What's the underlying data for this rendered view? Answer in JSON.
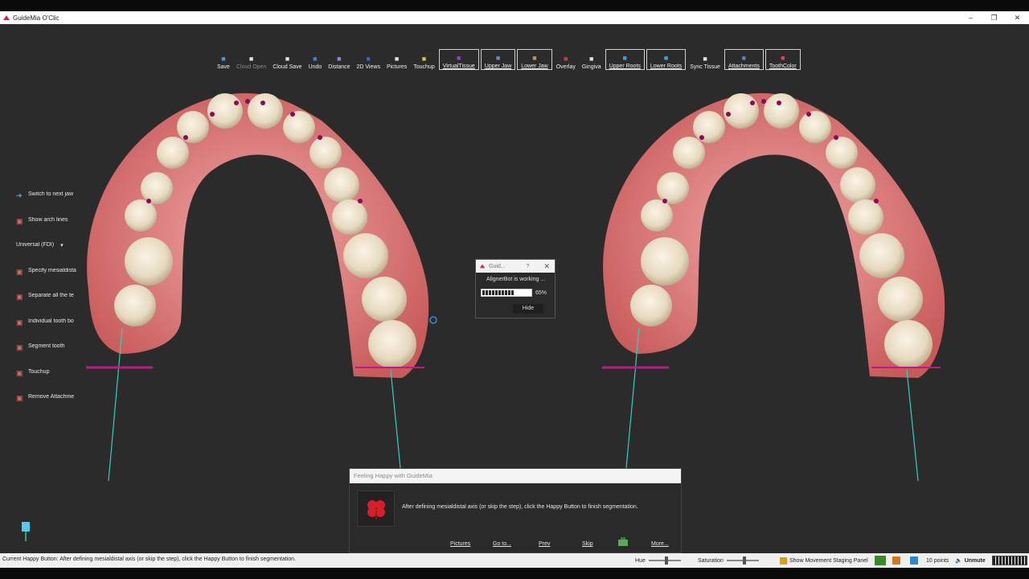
{
  "window": {
    "title": "GuideMia O'Clic",
    "minimize": "–",
    "restore": "❐",
    "close": "✕"
  },
  "toolbar": [
    {
      "label": "Save",
      "icon": "save-icon",
      "boxed": false,
      "disabled": false
    },
    {
      "label": "Cloud Open",
      "icon": "cloud-open-icon",
      "boxed": false,
      "disabled": true
    },
    {
      "label": "Cloud Save",
      "icon": "cloud-save-icon",
      "boxed": false,
      "disabled": false
    },
    {
      "label": "Undo",
      "icon": "undo-icon",
      "boxed": false,
      "disabled": false
    },
    {
      "label": "Distance",
      "icon": "distance-icon",
      "boxed": false,
      "disabled": false
    },
    {
      "label": "2D Views",
      "icon": "2d-views-icon",
      "boxed": false,
      "disabled": false
    },
    {
      "label": "Pictures",
      "icon": "pictures-icon",
      "boxed": false,
      "disabled": false
    },
    {
      "label": "Touchup",
      "icon": "touchup-icon",
      "boxed": false,
      "disabled": false
    },
    {
      "label": "VirtualTissue",
      "icon": "virtual-tissue-icon",
      "boxed": true,
      "disabled": false
    },
    {
      "label": "Upper Jaw",
      "icon": "upper-jaw-icon",
      "boxed": true,
      "disabled": false
    },
    {
      "label": "Lower Jaw",
      "icon": "lower-jaw-icon",
      "boxed": true,
      "disabled": false
    },
    {
      "label": "Overlay",
      "icon": "overlay-icon",
      "boxed": false,
      "disabled": false
    },
    {
      "label": "Gingiva",
      "icon": "gingiva-icon",
      "boxed": false,
      "disabled": false
    },
    {
      "label": "Upper Roots",
      "icon": "upper-roots-icon",
      "boxed": true,
      "disabled": false
    },
    {
      "label": "Lower Roots",
      "icon": "lower-roots-icon",
      "boxed": true,
      "disabled": false
    },
    {
      "label": "Sync Tissue",
      "icon": "sync-tissue-icon",
      "boxed": false,
      "disabled": false
    },
    {
      "label": "Attachments",
      "icon": "attachments-icon",
      "boxed": true,
      "disabled": false
    },
    {
      "label": "ToothColor",
      "icon": "tooth-color-icon",
      "boxed": true,
      "disabled": false
    }
  ],
  "sidepanel": [
    {
      "label": "Switch to next jaw",
      "icon": "arrow-right-icon"
    },
    {
      "label": "Show arch lines",
      "icon": "arch-lines-icon"
    },
    {
      "label": "Universal (FDI)",
      "icon": "",
      "dropdown": "▾"
    },
    {
      "label": "Specify mesialdista",
      "icon": "tooth-axis-icon"
    },
    {
      "label": "Separate all the te",
      "icon": "separate-teeth-icon"
    },
    {
      "label": "Individual tooth bo",
      "icon": "tooth-boundary-icon"
    },
    {
      "label": "Segment tooth",
      "icon": "segment-tooth-icon"
    },
    {
      "label": "Touchup",
      "icon": "touchup-icon"
    },
    {
      "label": "Remove Attachme",
      "icon": "remove-attachment-icon"
    }
  ],
  "progress_dialog": {
    "title": "Guid...",
    "help": "?",
    "close": "✕",
    "message": "AlignerBot is working ...",
    "progress": 0.65,
    "progress_text": "65%",
    "hide_label": "Hide"
  },
  "happy_panel": {
    "title": "Feeling Happy with GuideMia",
    "message": "After defining mesialdistal axis (or skip the step), click the Happy Button to finish segmentation.",
    "links": [
      "Pictures",
      "Go to...",
      "Prev",
      "Skip",
      "More..."
    ],
    "accent": "#d61f2a"
  },
  "statusbar": {
    "text": "Current Happy Button: After defining mesialdistal axis (or skip the step), click the Happy Button to finish segmentation.",
    "hue_label": "Hue",
    "saturation_label": "Saturation",
    "staging_label": "Show Movement Staging Panel",
    "points_label": "10 points",
    "unmute_label": "Unmute"
  },
  "colors": {
    "landmark": "#8b0a5a",
    "axis_line": "#2fd0c0",
    "arch_marker": "#c0188a"
  }
}
